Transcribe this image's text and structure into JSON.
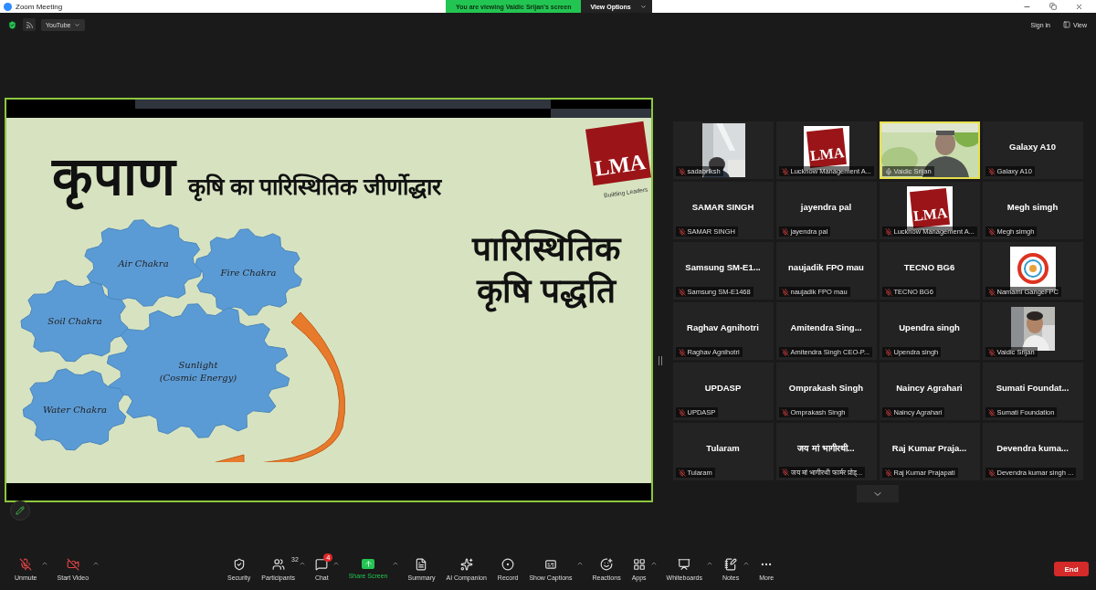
{
  "window": {
    "title": "Zoom Meeting"
  },
  "banner": {
    "text": "You are viewing Vaidic Srijan's screen",
    "button": "View Options"
  },
  "top_bar": {
    "dropdown": "YouTube",
    "sign_in": "Sign in",
    "view": "View"
  },
  "slide": {
    "title": "कृपाण",
    "subtitle": "कृषि का पारिस्थितिक जीर्णोद्धार",
    "logo": {
      "text": "LMA",
      "tagline": "Building Leaders"
    },
    "heading": [
      "पारिस्थितिक",
      "कृषि पद्धति"
    ],
    "gears": [
      {
        "lines": [
          "Air Chakra"
        ]
      },
      {
        "lines": [
          "Fire Chakra"
        ]
      },
      {
        "lines": [
          "Soil Chakra"
        ]
      },
      {
        "lines": [
          "Sunlight",
          "(Cosmic Energy)"
        ]
      },
      {
        "lines": [
          "Water Chakra"
        ]
      }
    ]
  },
  "participants": [
    {
      "kind": "video",
      "label": "sadabriksh",
      "muted": true,
      "speaking": false
    },
    {
      "kind": "logo",
      "logo_text": "LMA",
      "label": "Lucknow Management A...",
      "muted": true,
      "speaking": false
    },
    {
      "kind": "camera",
      "label": "Vaidic Srijan",
      "muted": false,
      "speaking": true
    },
    {
      "kind": "name",
      "name": "Galaxy A10",
      "label": "Galaxy A10",
      "muted": true,
      "speaking": false
    },
    {
      "kind": "name",
      "name": "SAMAR SINGH",
      "label": "SAMAR SINGH",
      "muted": true,
      "speaking": false
    },
    {
      "kind": "name",
      "name": "jayendra pal",
      "label": "jayendra pal",
      "muted": true,
      "speaking": false
    },
    {
      "kind": "logo",
      "logo_text": "LMA",
      "label": "Lucknow Management A...",
      "muted": true,
      "speaking": false
    },
    {
      "kind": "name",
      "name": "Megh simgh",
      "label": "Megh simgh",
      "muted": true,
      "speaking": false
    },
    {
      "kind": "name",
      "name": "Samsung  SM-E1...",
      "label": "Samsung SM-E1468",
      "muted": true,
      "speaking": false
    },
    {
      "kind": "name",
      "name": "naujadik FPO mau",
      "label": "naujadik FPO mau",
      "muted": true,
      "speaking": false
    },
    {
      "kind": "name",
      "name": "TECNO BG6",
      "label": "TECNO BG6",
      "muted": true,
      "speaking": false
    },
    {
      "kind": "emblem",
      "label": "Namami GangeFPC",
      "muted": true,
      "speaking": false
    },
    {
      "kind": "name",
      "name": "Raghav Agnihotri",
      "label": "Raghav Agnihotri",
      "muted": true,
      "speaking": false
    },
    {
      "kind": "name",
      "name": "Amitendra  Sing...",
      "label": "Amitendra Singh CEO-P...",
      "muted": true,
      "speaking": false
    },
    {
      "kind": "name",
      "name": "Upendra singh",
      "label": "Upendra singh",
      "muted": true,
      "speaking": false
    },
    {
      "kind": "avatar",
      "label": "Vaidic Srijan",
      "muted": true,
      "speaking": false
    },
    {
      "kind": "name",
      "name": "UPDASP",
      "label": "UPDASP",
      "muted": true,
      "speaking": false
    },
    {
      "kind": "name",
      "name": "Omprakash Singh",
      "label": "Omprakash Singh",
      "muted": true,
      "speaking": false
    },
    {
      "kind": "name",
      "name": "Naincy Agrahari",
      "label": "Naincy Agrahari",
      "muted": true,
      "speaking": false
    },
    {
      "kind": "name",
      "name": "Sumati  Foundat...",
      "label": "Sumati Foundation",
      "muted": true,
      "speaking": false
    },
    {
      "kind": "name",
      "name": "Tularam",
      "label": "Tularam",
      "muted": true,
      "speaking": false
    },
    {
      "kind": "name",
      "name": "जय मां भागीरथी...",
      "label": "जय मां भागीरथी फार्मर प्रोड्...",
      "muted": true,
      "speaking": false
    },
    {
      "kind": "name",
      "name": "Raj  Kumar  Praja...",
      "label": "Raj Kumar Prajapati",
      "muted": true,
      "speaking": false
    },
    {
      "kind": "name",
      "name": "Devendra  kuma...",
      "label": "Devendra kumar singh ...",
      "muted": true,
      "speaking": false
    }
  ],
  "toolbar": [
    {
      "kind": "mic",
      "label": "Unmute",
      "caret": true,
      "off": true
    },
    {
      "kind": "video",
      "label": "Start Video",
      "caret": true,
      "off": true
    },
    {
      "kind": "security",
      "label": "Security",
      "caret": false
    },
    {
      "kind": "participants",
      "label": "Participants",
      "count": "32",
      "caret": true
    },
    {
      "kind": "chat",
      "label": "Chat",
      "badge": "4",
      "caret": true
    },
    {
      "kind": "share",
      "label": "Share Screen",
      "caret": true
    },
    {
      "kind": "summary",
      "label": "Summary",
      "caret": false
    },
    {
      "kind": "ai",
      "label": "AI Companion",
      "caret": false
    },
    {
      "kind": "record",
      "label": "Record",
      "caret": false
    },
    {
      "kind": "captions",
      "label": "Show Captions",
      "caret": true
    },
    {
      "kind": "reactions",
      "label": "Reactions",
      "caret": false
    },
    {
      "kind": "apps",
      "label": "Apps",
      "caret": true
    },
    {
      "kind": "whiteboards",
      "label": "Whiteboards",
      "caret": true
    },
    {
      "kind": "notes",
      "label": "Notes",
      "caret": true
    },
    {
      "kind": "more",
      "label": "More",
      "caret": false
    }
  ],
  "end_button": "End"
}
